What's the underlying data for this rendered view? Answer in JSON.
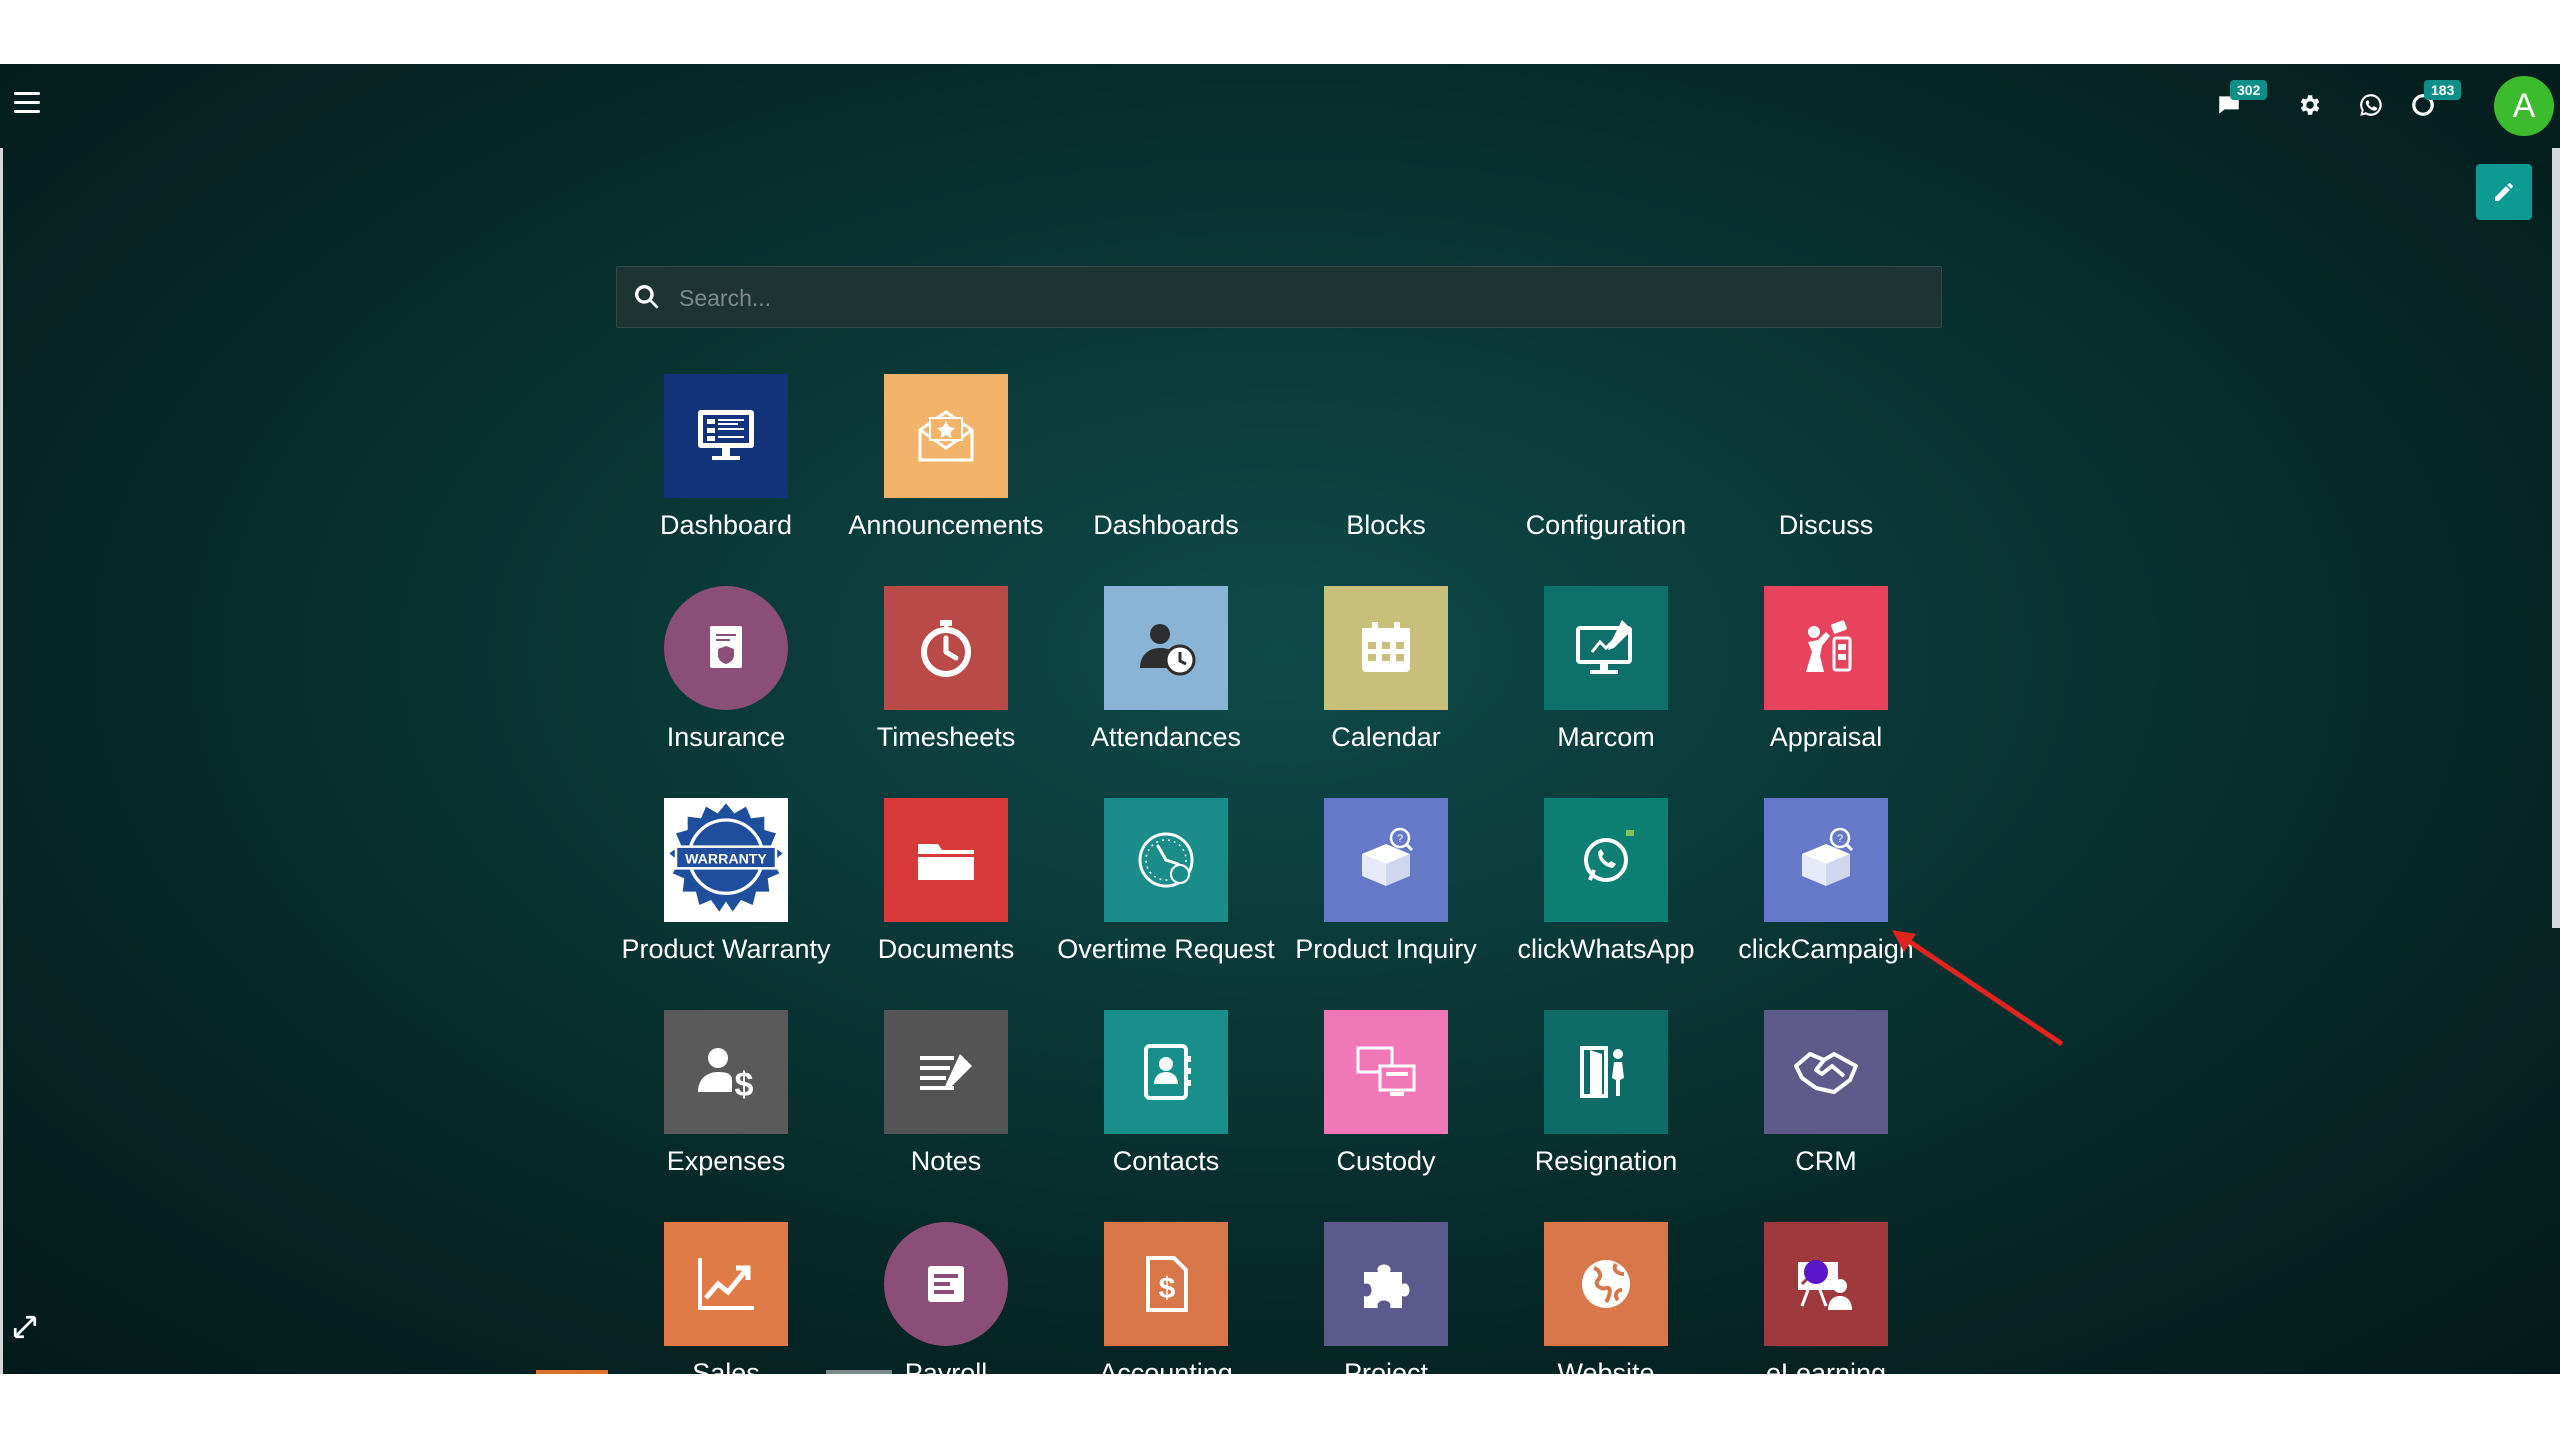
{
  "topbar": {
    "messages_badge": "302",
    "activity_badge": "183",
    "avatar_letter": "A"
  },
  "search": {
    "placeholder": "Search..."
  },
  "apps": [
    {
      "label": "Dashboard",
      "color": "#13347a",
      "icon": "dashboard-icon"
    },
    {
      "label": "Announcements",
      "color": "#f2b46a",
      "icon": "announcement-envelope-icon"
    },
    {
      "label": "Dashboards",
      "color": "",
      "icon": ""
    },
    {
      "label": "Blocks",
      "color": "",
      "icon": ""
    },
    {
      "label": "Configuration",
      "color": "",
      "icon": ""
    },
    {
      "label": "Discuss",
      "color": "",
      "icon": ""
    },
    {
      "label": "Insurance",
      "color": "#8b4e78",
      "icon": "insurance-document-icon"
    },
    {
      "label": "Timesheets",
      "color": "#b94a48",
      "icon": "stopwatch-icon"
    },
    {
      "label": "Attendances",
      "color": "#8ab4d6",
      "icon": "user-clock-icon"
    },
    {
      "label": "Calendar",
      "color": "#c8c07a",
      "icon": "calendar-icon"
    },
    {
      "label": "Marcom",
      "color": "#0f6f6b",
      "icon": "monitor-pen-icon"
    },
    {
      "label": "Appraisal",
      "color": "#e8435d",
      "icon": "appraisal-icon"
    },
    {
      "label": "Product Warranty",
      "color": "#1f4f9c",
      "icon": "warranty-seal-icon"
    },
    {
      "label": "Documents",
      "color": "#d83a3a",
      "icon": "folder-icon"
    },
    {
      "label": "Overtime Request",
      "color": "#1a8c89",
      "icon": "clock-gauge-icon"
    },
    {
      "label": "Product Inquiry",
      "color": "#6679c9",
      "icon": "box-question-icon"
    },
    {
      "label": "clickWhatsApp",
      "color": "#0d7f73",
      "icon": "whatsapp-icon"
    },
    {
      "label": "clickCampaign",
      "color": "#6679c9",
      "icon": "box-question-icon"
    },
    {
      "label": "Expenses",
      "color": "#5a5a5a",
      "icon": "user-dollar-icon"
    },
    {
      "label": "Notes",
      "color": "#555555",
      "icon": "notes-pen-icon"
    },
    {
      "label": "Contacts",
      "color": "#188f8a",
      "icon": "address-book-icon"
    },
    {
      "label": "Custody",
      "color": "#f078b8",
      "icon": "screens-icon"
    },
    {
      "label": "Resignation",
      "color": "#0e6b68",
      "icon": "exit-door-icon"
    },
    {
      "label": "CRM",
      "color": "#5e5a8a",
      "icon": "handshake-icon"
    },
    {
      "label": "Sales",
      "color": "#e07a46",
      "icon": "chart-up-icon"
    },
    {
      "label": "Payroll",
      "color": "#8b4e78",
      "icon": "payroll-icon"
    },
    {
      "label": "Accounting",
      "color": "#d8784a",
      "icon": "dollar-document-icon"
    },
    {
      "label": "Project",
      "color": "#5c5a8c",
      "icon": "puzzle-icon"
    },
    {
      "label": "Website",
      "color": "#d8784a",
      "icon": "globe-icon"
    },
    {
      "label": "eLearning",
      "color": "#9e3a3e",
      "icon": "teacher-board-icon"
    }
  ]
}
